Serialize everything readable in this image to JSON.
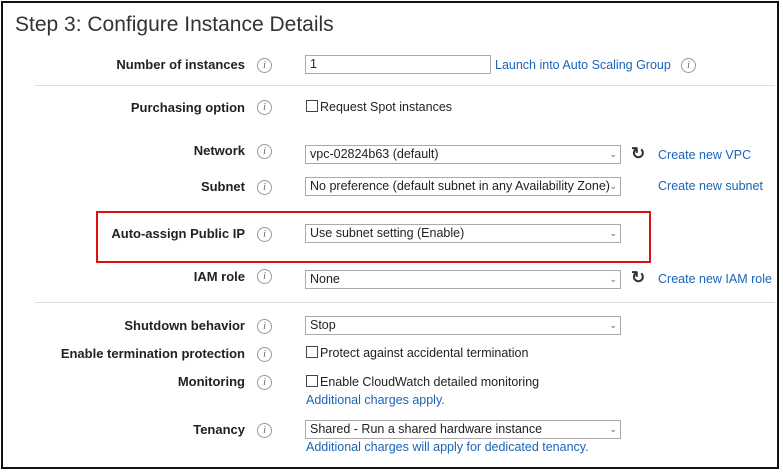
{
  "page": {
    "title": "Step 3: Configure Instance Details"
  },
  "rows": {
    "instances": {
      "label": "Number of instances",
      "value": "1",
      "link": "Launch into Auto Scaling Group"
    },
    "purchasing": {
      "label": "Purchasing option",
      "checkbox_label": "Request Spot instances",
      "checked": false
    },
    "network": {
      "label": "Network",
      "value": "vpc-02824b63 (default)",
      "link": "Create new VPC"
    },
    "subnet": {
      "label": "Subnet",
      "value": "No preference (default subnet in any Availability Zone)",
      "link": "Create new subnet"
    },
    "public_ip": {
      "label": "Auto-assign Public IP",
      "value": "Use subnet setting (Enable)"
    },
    "iam": {
      "label": "IAM role",
      "value": "None",
      "link": "Create new IAM role"
    },
    "shutdown": {
      "label": "Shutdown behavior",
      "value": "Stop"
    },
    "termination": {
      "label": "Enable termination protection",
      "checkbox_label": "Protect against accidental termination",
      "checked": false
    },
    "monitoring": {
      "label": "Monitoring",
      "checkbox_label": "Enable CloudWatch detailed monitoring",
      "checked": false,
      "note": "Additional charges apply."
    },
    "tenancy": {
      "label": "Tenancy",
      "value": "Shared - Run a shared hardware instance",
      "note": "Additional charges will apply for dedicated tenancy."
    }
  },
  "icons": {
    "info": "info-icon",
    "refresh": "refresh-icon",
    "caret": "chevron-down-icon"
  },
  "colors": {
    "link": "#1a64b8",
    "highlight_border": "#dd1111"
  }
}
